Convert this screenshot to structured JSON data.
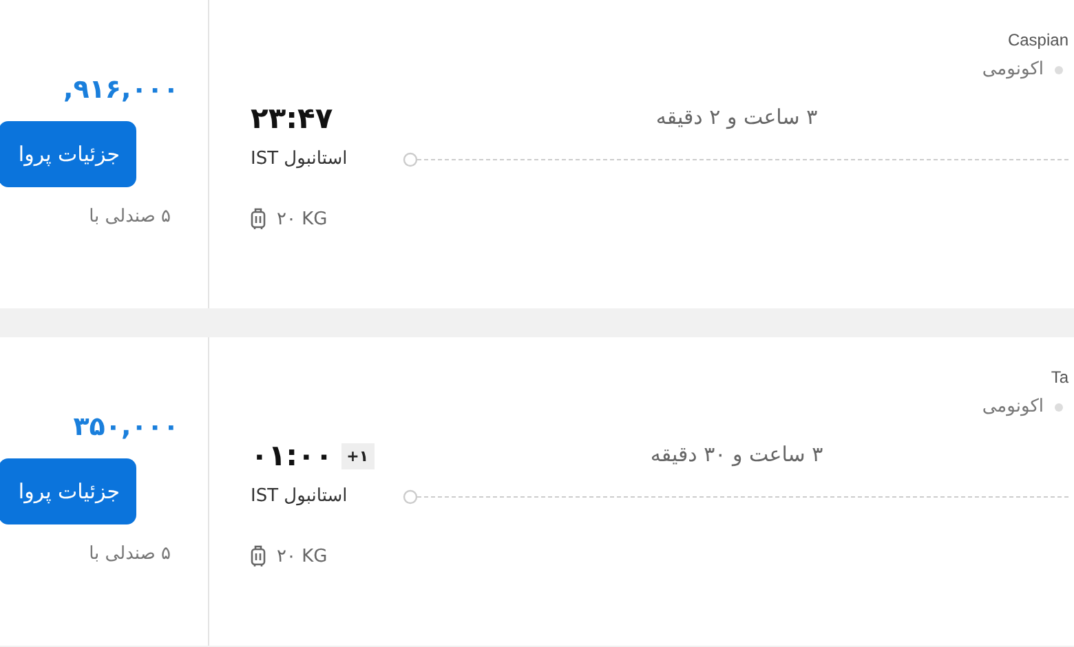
{
  "flights": [
    {
      "airline": "Caspian",
      "cabin": "اکونومی",
      "duration": "۳ ساعت و ۲ دقیقه",
      "arrival_time": "۲۳:۴۷",
      "arrival_airport": "استانبول IST",
      "baggage": "۲۰ KG",
      "price": ",۹۱۶,۰۰۰",
      "details_button": "جزئیات پروا",
      "seats": "۵ صندلی با"
    },
    {
      "airline": "Ta",
      "cabin": "اکونومی",
      "duration": "۳ ساعت و ۳۰ دقیقه",
      "arrival_time": "۰۱:۰۰",
      "day_offset": "+۱",
      "arrival_airport": "استانبول IST",
      "baggage": "۲۰ KG",
      "price": "۳۵۰,۰۰۰",
      "details_button": "جزئیات پروا",
      "seats": "۵ صندلی با"
    }
  ]
}
